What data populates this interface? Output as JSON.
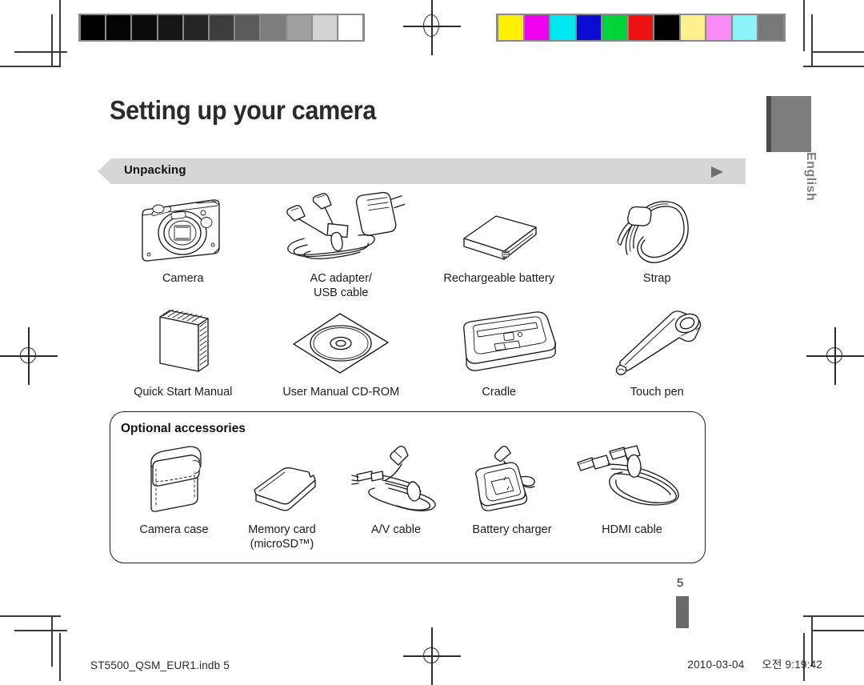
{
  "document": {
    "page_title": "Setting up your camera",
    "page_number": "5",
    "language_tab": "English"
  },
  "section": {
    "heading": "Unpacking",
    "arrow_icon": "play-triangle-icon"
  },
  "included_items": [
    {
      "caption": "Camera",
      "icon": "camera-icon"
    },
    {
      "caption": "AC adapter/\nUSB cable",
      "icon": "ac-adapter-usb-cable-icon"
    },
    {
      "caption": "Rechargeable battery",
      "icon": "battery-icon"
    },
    {
      "caption": "Strap",
      "icon": "strap-icon"
    },
    {
      "caption": "Quick Start Manual",
      "icon": "manual-booklet-icon"
    },
    {
      "caption": "User Manual CD-ROM",
      "icon": "cd-rom-icon"
    },
    {
      "caption": "Cradle",
      "icon": "cradle-icon"
    },
    {
      "caption": "Touch pen",
      "icon": "touch-pen-icon"
    }
  ],
  "optional": {
    "title": "Optional accessories",
    "items": [
      {
        "caption": "Camera case",
        "icon": "camera-case-icon"
      },
      {
        "caption": "Memory card\n(microSD™)",
        "icon": "memory-card-icon"
      },
      {
        "caption": "A/V cable",
        "icon": "av-cable-icon"
      },
      {
        "caption": "Battery charger",
        "icon": "battery-charger-icon"
      },
      {
        "caption": "HDMI cable",
        "icon": "hdmi-cable-icon"
      }
    ]
  },
  "print_marks": {
    "grayscale_swatches": [
      "#000000",
      "#030303",
      "#0b0b0b",
      "#151515",
      "#252525",
      "#3d3d3d",
      "#5a5a5a",
      "#7d7d7d",
      "#a0a0a0",
      "#d2d2d2",
      "#ffffff"
    ],
    "color_swatches": [
      "#ffef00",
      "#ef00ef",
      "#00e8ef",
      "#0b0bd2",
      "#00d43a",
      "#ee1111",
      "#000000",
      "#fdf08d",
      "#fb8bf6",
      "#8df3fb",
      "#787878"
    ],
    "registration_icon": "registration-crosshair-icon"
  },
  "footer": {
    "left": "ST5500_QSM_EUR1.indb   5",
    "right_date": "2010-03-04",
    "right_meridiem": "오전",
    "right_time": "9:19:42"
  }
}
